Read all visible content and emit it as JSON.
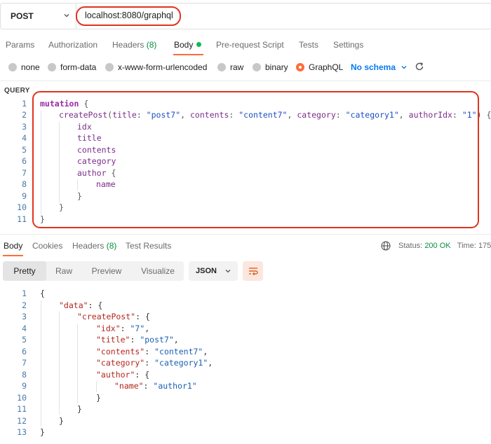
{
  "request": {
    "method": "POST",
    "url": "localhost:8080/graphql"
  },
  "tabs": [
    {
      "label": "Params"
    },
    {
      "label": "Authorization"
    },
    {
      "label": "Headers",
      "count": "(8)"
    },
    {
      "label": "Body"
    },
    {
      "label": "Pre-request Script"
    },
    {
      "label": "Tests"
    },
    {
      "label": "Settings"
    }
  ],
  "body_types": [
    {
      "label": "none",
      "selected": false
    },
    {
      "label": "form-data",
      "selected": false
    },
    {
      "label": "x-www-form-urlencoded",
      "selected": false
    },
    {
      "label": "raw",
      "selected": false
    },
    {
      "label": "binary",
      "selected": false
    },
    {
      "label": "GraphQL",
      "selected": true
    }
  ],
  "schema_label": "No schema",
  "query_label": "QUERY",
  "query": {
    "line_numbers": [
      "1",
      "2",
      "3",
      "4",
      "5",
      "6",
      "7",
      "8",
      "9",
      "10",
      "11"
    ],
    "mutation_kw": "mutation",
    "open_brace": "{",
    "fn_name": "createPost",
    "args": [
      {
        "name": "title",
        "value": "\"post7\""
      },
      {
        "name": "contents",
        "value": "\"content7\""
      },
      {
        "name": "category",
        "value": "\"category1\""
      },
      {
        "name": "authorIdx",
        "value": "\"1\""
      }
    ],
    "fields": [
      "idx",
      "title",
      "contents",
      "category"
    ],
    "author_field": "author",
    "name_field": "name"
  },
  "response": {
    "tabs": [
      {
        "label": "Body"
      },
      {
        "label": "Cookies"
      },
      {
        "label": "Headers",
        "count": "(8)"
      },
      {
        "label": "Test Results"
      }
    ],
    "status_label": "Status:",
    "status_value": "200 OK",
    "time_label": "Time: 175",
    "view_modes": [
      "Pretty",
      "Raw",
      "Preview",
      "Visualize"
    ],
    "format": "JSON",
    "line_numbers": [
      "1",
      "2",
      "3",
      "4",
      "5",
      "6",
      "7",
      "8",
      "9",
      "10",
      "11",
      "12",
      "13"
    ],
    "json": {
      "data_key": "\"data\"",
      "createPost_key": "\"createPost\"",
      "entries": [
        {
          "key": "\"idx\"",
          "value": "\"7\""
        },
        {
          "key": "\"title\"",
          "value": "\"post7\""
        },
        {
          "key": "\"contents\"",
          "value": "\"content7\""
        },
        {
          "key": "\"category\"",
          "value": "\"category1\""
        }
      ],
      "author_key": "\"author\"",
      "name_key": "\"name\"",
      "name_value": "\"author1\""
    }
  },
  "colors": {
    "accent": "#ff6c37",
    "annotation": "#e0331e",
    "status_ok": "#0a8f3e",
    "link_blue": "#097bed"
  },
  "icons": [
    "chevron-down-icon",
    "refresh-icon",
    "globe-icon",
    "wrap-lines-icon"
  ]
}
